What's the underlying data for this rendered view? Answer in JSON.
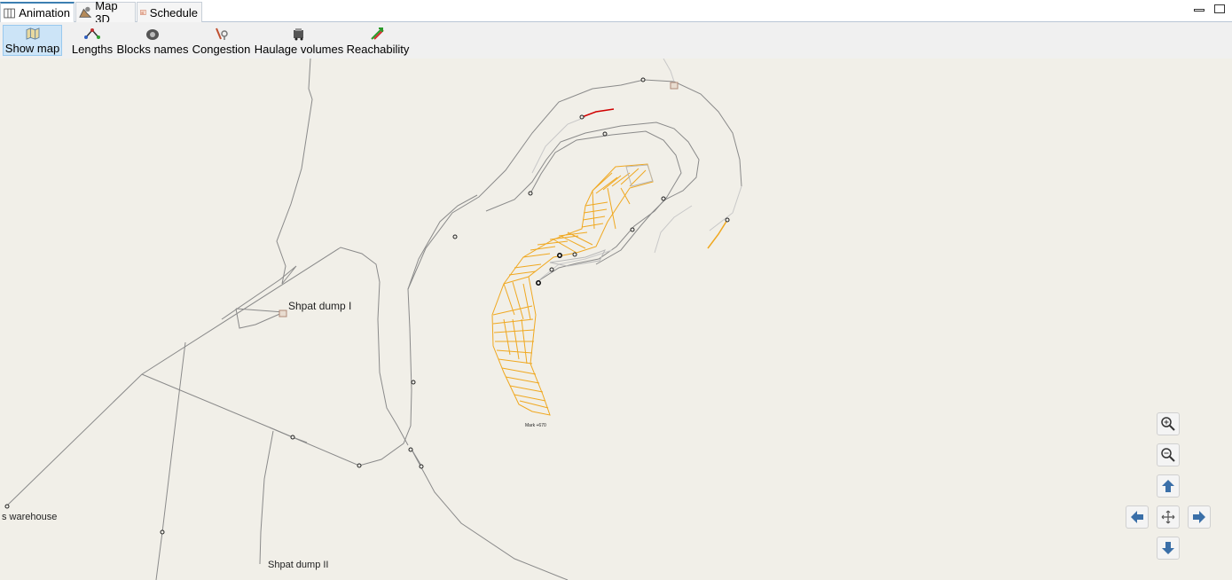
{
  "tabs": [
    {
      "label": "Animation",
      "icon": "map-book-icon",
      "active": true
    },
    {
      "label": "Map 3D",
      "icon": "map-3d-icon",
      "active": false
    },
    {
      "label": "Schedule",
      "icon": "schedule-icon",
      "active": false
    }
  ],
  "toolbar": {
    "items": [
      {
        "label": "Show map",
        "icon": "show-map-icon",
        "active": true
      },
      {
        "label": "Lengths",
        "icon": "lengths-icon",
        "active": false
      },
      {
        "label": "Blocks names",
        "icon": "blocks-names-icon",
        "active": false
      },
      {
        "label": "Congestion",
        "icon": "congestion-icon",
        "active": false
      },
      {
        "label": "Haulage volumes",
        "icon": "haulage-volumes-icon",
        "active": false
      },
      {
        "label": "Reachability",
        "icon": "reachability-icon",
        "active": false
      }
    ]
  },
  "map": {
    "labels": {
      "shpat_dump_1": "Shpat dump I",
      "warehouse": "s warehouse",
      "shpat_dump_2": "Shpat dump II",
      "mark": "Mark +670"
    },
    "colors": {
      "background": "#f1efe8",
      "road": "#8a8a8a",
      "road_faint": "#c8c8c8",
      "block": "#f0a820",
      "highlight_road": "#d00000"
    }
  },
  "nav_controls": {
    "zoom_in": "zoom-in-icon",
    "zoom_out": "zoom-out-icon",
    "pan_up": "arrow-up-icon",
    "pan_left": "arrow-left-icon",
    "center": "center-move-icon",
    "pan_right": "arrow-right-icon",
    "pan_down": "arrow-down-icon"
  }
}
